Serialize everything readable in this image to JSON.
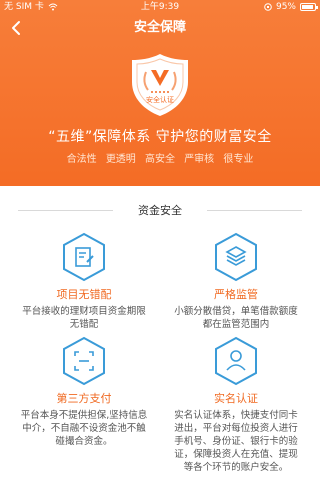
{
  "status_bar": {
    "carrier": "无 SIM 卡",
    "time": "上午9:39",
    "battery": "95%",
    "battery_level": 0.95
  },
  "nav": {
    "title": "安全保障"
  },
  "hero": {
    "badge_text": "安全认证",
    "slogan": "“五维”保障体系  守护您的财富安全",
    "features": [
      "合法性",
      "更透明",
      "高安全",
      "严审核",
      "很专业"
    ]
  },
  "section": {
    "title": "资金安全"
  },
  "items": [
    {
      "title": "项目无错配",
      "desc": "平台接收的理财项目资金期限无错配",
      "icon": "document-edit-icon"
    },
    {
      "title": "严格监管",
      "desc": "小额分散借贷，单笔借款额度都在监管范围内",
      "icon": "layers-icon"
    },
    {
      "title": "第三方支付",
      "desc": "平台本身不提供担保,坚持信息中介，不自融不设资金池不触碰撮合资金。",
      "icon": "scan-icon"
    },
    {
      "title": "实名认证",
      "desc": "实名认证体系，快捷支付同卡进出，平台对每位投资人进行手机号、身份证、银行卡的验证，保障投资人在充值、提现等各个环节的账户安全。",
      "icon": "user-icon"
    }
  ],
  "colors": {
    "brand_orange": "#f46c25",
    "accent_blue": "#3a9bd8"
  }
}
